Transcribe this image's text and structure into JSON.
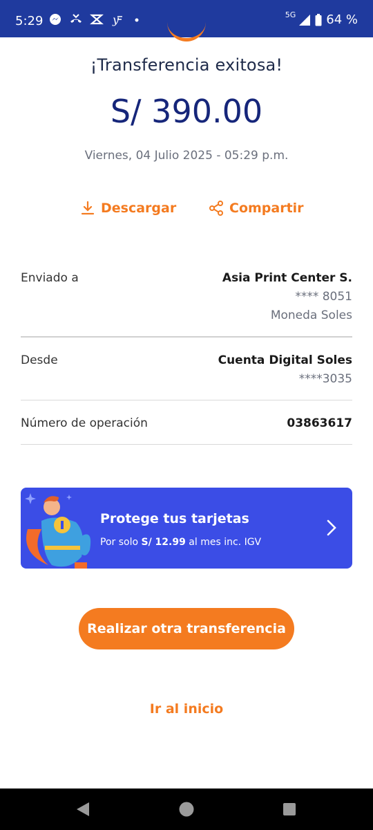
{
  "status_bar": {
    "time": "5:29",
    "network": "5G",
    "battery": "64 %"
  },
  "receipt": {
    "title": "¡Transferencia exitosa!",
    "amount": "S/ 390.00",
    "datetime": "Viernes, 04 Julio 2025 - 05:29 p.m."
  },
  "actions": {
    "download_label": "Descargar",
    "share_label": "Compartir"
  },
  "details": {
    "sent_to": {
      "label": "Enviado a",
      "name": "Asia Print Center S.",
      "account": "**** 8051",
      "currency": "Moneda Soles"
    },
    "from": {
      "label": "Desde",
      "account_name": "Cuenta Digital Soles",
      "account": "****3035"
    },
    "operation": {
      "label": "Número de operación",
      "number": "03863617"
    }
  },
  "promo": {
    "title": "Protege tus tarjetas",
    "subtitle_prefix": "Por solo ",
    "price": "S/ 12.99",
    "subtitle_suffix": " al mes inc. IGV"
  },
  "buttons": {
    "another_transfer": "Realizar otra transferencia",
    "go_home": "Ir al inicio"
  },
  "colors": {
    "accent": "#f47b20",
    "status_bar": "#1f3a9e",
    "amount": "#16267a",
    "promo_bg": "#3b4de6"
  }
}
